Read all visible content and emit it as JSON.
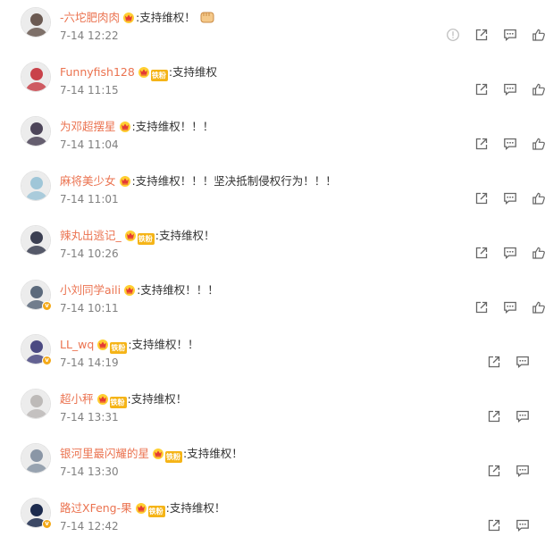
{
  "comments": [
    {
      "name": "-六坨肥肉肉",
      "badge": "crown",
      "text": ":支持维权！",
      "time": "7-14 12:22",
      "avatar_color": "#6b5a52",
      "verified": false,
      "emoji": "fist"
    },
    {
      "name": "Funnyfish128",
      "badge": "fan",
      "fan_label": "铁粉",
      "text": ":支持维权",
      "time": "7-14 11:15",
      "avatar_color": "#c9424a",
      "verified": false
    },
    {
      "name": "为邓超摆星",
      "badge": "crown",
      "text": ":支持维权！！！",
      "time": "7-14 11:04",
      "avatar_color": "#4d4559",
      "verified": false
    },
    {
      "name": "麻将美少女",
      "badge": "crown",
      "text": ":支持维权！！！坚决抵制侵权行为！！！",
      "time": "7-14 11:01",
      "avatar_color": "#9fc6d8",
      "verified": false
    },
    {
      "name": "辣丸出逃记_",
      "badge": "fan",
      "fan_label": "铁粉",
      "text": ":支持维权！",
      "time": "7-14 10:26",
      "avatar_color": "#3b3f52",
      "verified": false
    },
    {
      "name": "小刘同学aili",
      "badge": "crown",
      "text": ":支持维权！！！",
      "time": "7-14 10:11",
      "avatar_color": "#5c6a7c",
      "verified": true
    },
    {
      "name": "LL_wq",
      "badge": "fan",
      "fan_label": "铁粉",
      "text": ":支持维权！！",
      "time": "7-14 14:19",
      "avatar_color": "#4b4a82",
      "verified": true
    },
    {
      "name": "超小秤",
      "badge": "fan",
      "fan_label": "铁粉",
      "text": ":支持维权！",
      "time": "7-14 13:31",
      "avatar_color": "#bdbab8",
      "verified": false
    },
    {
      "name": "银河里最闪耀的星",
      "badge": "fan",
      "fan_label": "铁粉",
      "text": ":支持维权！",
      "time": "7-14 13:30",
      "avatar_color": "#8a96a6",
      "verified": false
    },
    {
      "name": "路过XFeng-果",
      "badge": "fan",
      "fan_label": "铁粉",
      "text": ":支持维权！",
      "time": "7-14 12:42",
      "avatar_color": "#1d2b4e",
      "verified": true
    }
  ],
  "colors": {
    "name": "#eb7350",
    "text": "#333333",
    "time": "#808080",
    "icon": "#666666",
    "fan_badge": "#f5b417"
  }
}
